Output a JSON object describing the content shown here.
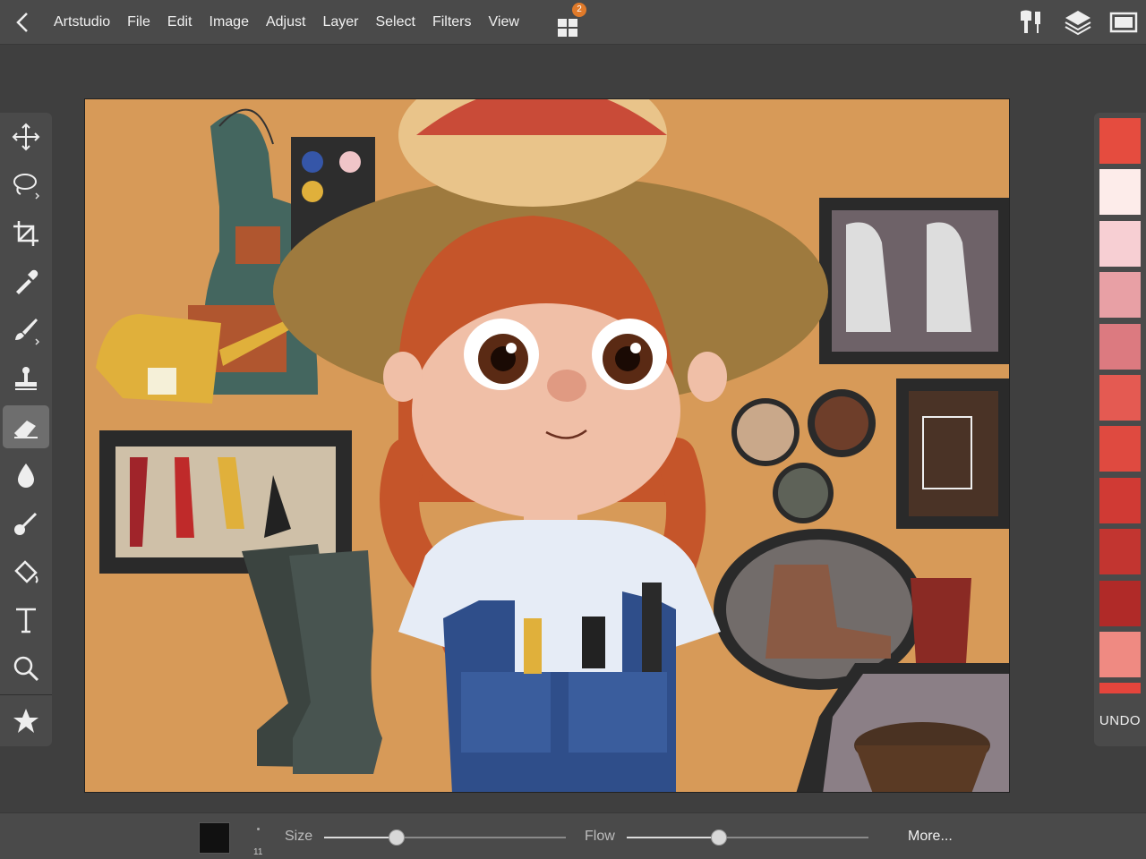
{
  "menu": {
    "app": "Artstudio",
    "file": "File",
    "edit": "Edit",
    "image": "Image",
    "adjust": "Adjust",
    "layer": "Layer",
    "select": "Select",
    "filters": "Filters",
    "view": "View"
  },
  "apps_badge": "2",
  "top_right_icons": [
    "brush-options-icon",
    "layers-icon",
    "fullscreen-icon"
  ],
  "tools": [
    {
      "name": "move-tool",
      "icon": "move-icon"
    },
    {
      "name": "lasso-tool",
      "icon": "lasso-icon"
    },
    {
      "name": "crop-tool",
      "icon": "crop-icon"
    },
    {
      "name": "eyedropper-tool",
      "icon": "eyedropper-icon"
    },
    {
      "name": "brush-tool",
      "icon": "brush-icon"
    },
    {
      "name": "stamp-tool",
      "icon": "stamp-icon"
    },
    {
      "name": "eraser-tool",
      "icon": "eraser-icon",
      "active": true
    },
    {
      "name": "blur-tool",
      "icon": "drop-icon"
    },
    {
      "name": "smudge-tool",
      "icon": "smudge-icon"
    },
    {
      "name": "fill-tool",
      "icon": "paint-bucket-icon"
    },
    {
      "name": "text-tool",
      "icon": "text-icon"
    },
    {
      "name": "zoom-tool",
      "icon": "magnifier-icon"
    },
    {
      "name": "favorites-tool",
      "icon": "star-icon"
    }
  ],
  "palette": {
    "colors": [
      "#e54c3f",
      "#fdecea",
      "#f7cfd3",
      "#e8a0a5",
      "#dc7a80",
      "#e45a52",
      "#df4a40",
      "#d03a34",
      "#c23530",
      "#b02a28",
      "#ef8a82",
      "#e5453c"
    ],
    "undo_label": "UNDO"
  },
  "bottom": {
    "brush_size_value": "11",
    "size_label": "Size",
    "size_value": 0.3,
    "flow_label": "Flow",
    "flow_value": 0.38,
    "more_label": "More...",
    "current_color": "#111111"
  }
}
